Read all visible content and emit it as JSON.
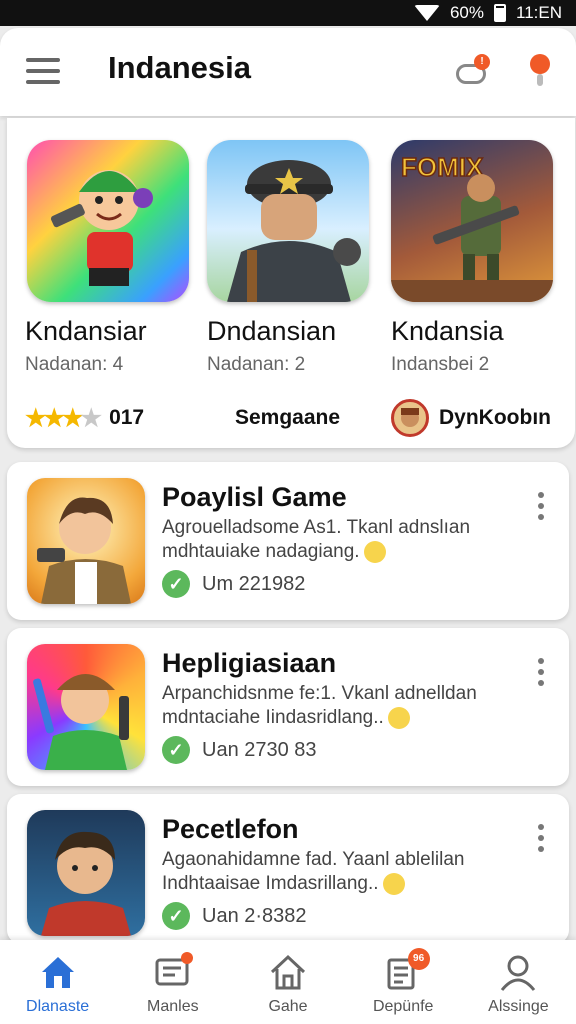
{
  "status_bar": {
    "battery_text": "60%",
    "time": "11:EN"
  },
  "header": {
    "title": "Indanesia"
  },
  "featured": [
    {
      "title": "Kndansiar",
      "subtitle": "Nadanan: 4",
      "meta": "017",
      "rating": 3.5
    },
    {
      "title": "Dndansian",
      "subtitle": "Nadanan: 2",
      "meta": "Semgaane"
    },
    {
      "title": "Kndansia",
      "subtitle": "Indansbei 2",
      "meta": "DynKoobın",
      "art_text": "FOMIX"
    }
  ],
  "list": [
    {
      "title": "Poaylisl Game",
      "description": "Agrouelladsome As1. Tkanl adnslıan mdhtauiake nadagiang.",
      "count": "Um 221982"
    },
    {
      "title": "Hepligiasiaan",
      "description": "Arpanchidsnme fe:1. Vkanl adnelldan mdntaciahe Iindasridlang..",
      "count": "Uan 2730 83"
    },
    {
      "title": "Pecetlefon",
      "description": "Agaonahidamne fad. Yaanl ablelilan Indhtaaisae Imdasrillang..",
      "count": "Uan 2·8382"
    }
  ],
  "bottom_nav": [
    {
      "label": "Dlanaste",
      "icon": "home-icon",
      "active": true
    },
    {
      "label": "Manles",
      "icon": "message-icon"
    },
    {
      "label": "Gahe",
      "icon": "house-outline-icon"
    },
    {
      "label": "Depünfe",
      "icon": "receipt-icon",
      "badge": "96"
    },
    {
      "label": "Alssinge",
      "icon": "person-icon"
    }
  ],
  "colors": {
    "accent": "#2a6fd6",
    "badge": "#f05a28",
    "check": "#5cb85c",
    "star": "#f5b800"
  }
}
